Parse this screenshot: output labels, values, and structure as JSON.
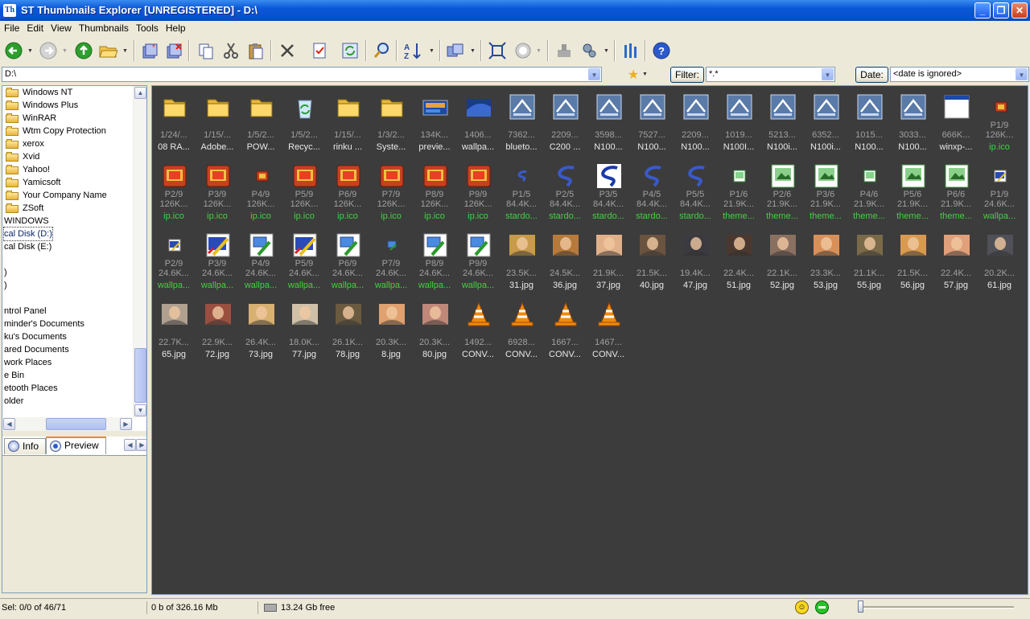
{
  "window": {
    "title": "ST Thumbnails Explorer [UNREGISTERED] - D:\\",
    "app_icon_text": "Th"
  },
  "menu": [
    {
      "label": "File"
    },
    {
      "label": "Edit"
    },
    {
      "label": "View"
    },
    {
      "label": "Thumbnails"
    },
    {
      "label": "Tools"
    },
    {
      "label": "Help"
    }
  ],
  "toolbar": {
    "icons": [
      "back-icon",
      "forward-icon",
      "up-icon",
      "folder-open-icon",
      "new-item-icon",
      "delete-item-icon",
      "copy-icon",
      "cut-icon",
      "paste-icon",
      "delete-icon",
      "properties-icon",
      "refresh-icon",
      "search-icon",
      "sort-icon",
      "view-mode-icon",
      "fit-icon",
      "stop-icon",
      "plugin-icon",
      "settings-icon",
      "tools-icon",
      "help-icon"
    ]
  },
  "address": {
    "value": "D:\\"
  },
  "filter": {
    "button": "Filter:",
    "value": "*.*"
  },
  "date": {
    "button": "Date:",
    "value": "<date is ignored>"
  },
  "tree": [
    {
      "label": "Windows NT",
      "folder": true
    },
    {
      "label": "Windows Plus",
      "folder": true
    },
    {
      "label": "WinRAR",
      "folder": true
    },
    {
      "label": "Wtm Copy Protection",
      "folder": true
    },
    {
      "label": "xerox",
      "folder": true
    },
    {
      "label": "Xvid",
      "folder": true
    },
    {
      "label": "Yahoo!",
      "folder": true
    },
    {
      "label": "Yamicsoft",
      "folder": true
    },
    {
      "label": "Your Company Name",
      "folder": true
    },
    {
      "label": "ZSoft",
      "folder": true
    },
    {
      "label": "WINDOWS",
      "folder": false
    },
    {
      "label": "cal Disk (D:)",
      "folder": false,
      "selected": true
    },
    {
      "label": "cal Disk (E:)",
      "folder": false
    },
    {
      "label": "",
      "folder": false
    },
    {
      "label": ")",
      "folder": false
    },
    {
      "label": ")",
      "folder": false
    },
    {
      "label": "",
      "folder": false
    },
    {
      "label": "ntrol Panel",
      "folder": false
    },
    {
      "label": "minder's Documents",
      "folder": false
    },
    {
      "label": "ku's Documents",
      "folder": false
    },
    {
      "label": "ared Documents",
      "folder": false
    },
    {
      "label": "work Places",
      "folder": false
    },
    {
      "label": "e Bin",
      "folder": false
    },
    {
      "label": "etooth Places",
      "folder": false
    },
    {
      "label": "older",
      "folder": false
    }
  ],
  "tabs": [
    {
      "label": "Info"
    },
    {
      "label": "Preview"
    }
  ],
  "thumbnails": [
    {
      "line1": "1/24/...",
      "line3": "08 RA...",
      "kind": "folder"
    },
    {
      "line1": "1/15/...",
      "line3": "Adobe...",
      "kind": "folder"
    },
    {
      "line1": "1/5/2...",
      "line3": "POW...",
      "kind": "folder"
    },
    {
      "line1": "1/5/2...",
      "line3": "Recyc...",
      "kind": "recycle"
    },
    {
      "line1": "1/15/...",
      "line3": "rinku ...",
      "kind": "folder"
    },
    {
      "line1": "1/3/2...",
      "line3": "Syste...",
      "kind": "folder"
    },
    {
      "line1": "134K...",
      "line3": "previe...",
      "kind": "screen"
    },
    {
      "line1": "1406...",
      "line3": "wallpa...",
      "kind": "wallpaper"
    },
    {
      "line1": "7362...",
      "line3": "blueto...",
      "kind": "doc"
    },
    {
      "line1": "2209...",
      "line3": "C200 ...",
      "kind": "doc"
    },
    {
      "line1": "3598...",
      "line3": "N100...",
      "kind": "doc"
    },
    {
      "line1": "7527...",
      "line3": "N100...",
      "kind": "doc"
    },
    {
      "line1": "2209...",
      "line3": "N100...",
      "kind": "doc"
    },
    {
      "line1": "1019...",
      "line3": "N100I...",
      "kind": "doc"
    },
    {
      "line1": "5213...",
      "line3": "N100i...",
      "kind": "doc"
    },
    {
      "line1": "6352...",
      "line3": "N100i...",
      "kind": "doc"
    },
    {
      "line1": "1015...",
      "line3": "N100...",
      "kind": "doc"
    },
    {
      "line1": "3033...",
      "line3": "N100...",
      "kind": "doc"
    },
    {
      "line1": "666K...",
      "line3": "winxp-...",
      "kind": "window"
    },
    {
      "line2": "P1/9",
      "line1": "126K...",
      "line3": "ip.ico",
      "kind": "book-small",
      "green": true
    },
    {
      "line2": "P2/9",
      "line1": "126K...",
      "line3": "ip.ico",
      "kind": "book",
      "green": true
    },
    {
      "line2": "P3/9",
      "line1": "126K...",
      "line3": "ip.ico",
      "kind": "book",
      "green": true
    },
    {
      "line2": "P4/9",
      "line1": "126K...",
      "line3": "ip.ico",
      "kind": "book-small",
      "green": true
    },
    {
      "line2": "P5/9",
      "line1": "126K...",
      "line3": "ip.ico",
      "kind": "book",
      "green": true
    },
    {
      "line2": "P6/9",
      "line1": "126K...",
      "line3": "ip.ico",
      "kind": "book",
      "green": true
    },
    {
      "line2": "P7/9",
      "line1": "126K...",
      "line3": "ip.ico",
      "kind": "book",
      "green": true
    },
    {
      "line2": "P8/9",
      "line1": "126K...",
      "line3": "ip.ico",
      "kind": "book",
      "green": true
    },
    {
      "line2": "P9/9",
      "line1": "126K...",
      "line3": "ip.ico",
      "kind": "book",
      "green": true
    },
    {
      "line2": "P1/5",
      "line1": "84.4K...",
      "line3": "stardo...",
      "kind": "star-small",
      "green": true
    },
    {
      "line2": "P2/5",
      "line1": "84.4K...",
      "line3": "stardo...",
      "kind": "star",
      "green": true
    },
    {
      "line2": "P3/5",
      "line1": "84.4K...",
      "line3": "stardo...",
      "kind": "star-white",
      "green": true
    },
    {
      "line2": "P4/5",
      "line1": "84.4K...",
      "line3": "stardo...",
      "kind": "star",
      "green": true
    },
    {
      "line2": "P5/5",
      "line1": "84.4K...",
      "line3": "stardo...",
      "kind": "star",
      "green": true
    },
    {
      "line2": "P1/6",
      "line1": "21.9K...",
      "line3": "theme...",
      "kind": "theme-small",
      "green": true
    },
    {
      "line2": "P2/6",
      "line1": "21.9K...",
      "line3": "theme...",
      "kind": "theme",
      "green": true
    },
    {
      "line2": "P3/6",
      "line1": "21.9K...",
      "line3": "theme...",
      "kind": "theme",
      "green": true
    },
    {
      "line2": "P4/6",
      "line1": "21.9K...",
      "line3": "theme...",
      "kind": "theme-small",
      "green": true
    },
    {
      "line2": "P5/6",
      "line1": "21.9K...",
      "line3": "theme...",
      "kind": "theme",
      "green": true
    },
    {
      "line2": "P6/6",
      "line1": "21.9K...",
      "line3": "theme...",
      "kind": "theme",
      "green": true
    },
    {
      "line2": "P1/9",
      "line1": "24.6K...",
      "line3": "wallpa...",
      "kind": "paint-small",
      "green": true
    },
    {
      "line2": "P2/9",
      "line1": "24.6K...",
      "line3": "wallpa...",
      "kind": "paint-small",
      "green": true
    },
    {
      "line2": "P3/9",
      "line1": "24.6K...",
      "line3": "wallpa...",
      "kind": "paint",
      "green": true
    },
    {
      "line2": "P4/9",
      "line1": "24.6K...",
      "line3": "wallpa...",
      "kind": "monitor",
      "green": true
    },
    {
      "line2": "P5/9",
      "line1": "24.6K...",
      "line3": "wallpa...",
      "kind": "paint",
      "green": true
    },
    {
      "line2": "P6/9",
      "line1": "24.6K...",
      "line3": "wallpa...",
      "kind": "monitor",
      "green": true
    },
    {
      "line2": "P7/9",
      "line1": "24.6K...",
      "line3": "wallpa...",
      "kind": "monitor-small",
      "green": true
    },
    {
      "line2": "P8/9",
      "line1": "24.6K...",
      "line3": "wallpa...",
      "kind": "monitor",
      "green": true
    },
    {
      "line2": "P9/9",
      "line1": "24.6K...",
      "line3": "wallpa...",
      "kind": "monitor",
      "green": true
    },
    {
      "line1": "23.5K...",
      "line3": "31.jpg",
      "kind": "photo",
      "tone": "#c89a4a"
    },
    {
      "line1": "24.5K...",
      "line3": "36.jpg",
      "kind": "photo",
      "tone": "#b87a3a"
    },
    {
      "line1": "21.9K...",
      "line3": "37.jpg",
      "kind": "photo",
      "tone": "#e0b08a"
    },
    {
      "line1": "21.5K...",
      "line3": "40.jpg",
      "kind": "photo",
      "tone": "#6a5440"
    },
    {
      "line1": "19.4K...",
      "line3": "47.jpg",
      "kind": "photo",
      "tone": "#3a3a40"
    },
    {
      "line1": "22.4K...",
      "line3": "51.jpg",
      "kind": "photo",
      "tone": "#4a3830"
    },
    {
      "line1": "22.1K...",
      "line3": "52.jpg",
      "kind": "photo",
      "tone": "#8a7060"
    },
    {
      "line1": "23.3K...",
      "line3": "53.jpg",
      "kind": "photo",
      "tone": "#d8905a"
    },
    {
      "line1": "21.1K...",
      "line3": "55.jpg",
      "kind": "photo",
      "tone": "#7a6a4a"
    },
    {
      "line1": "21.5K...",
      "line3": "56.jpg",
      "kind": "photo",
      "tone": "#d89a50"
    },
    {
      "line1": "22.4K...",
      "line3": "57.jpg",
      "kind": "photo",
      "tone": "#e0a07a"
    },
    {
      "line1": "20.2K...",
      "line3": "61.jpg",
      "kind": "photo",
      "tone": "#505058"
    },
    {
      "line1": "22.7K...",
      "line3": "65.jpg",
      "kind": "photo",
      "tone": "#b0a090"
    },
    {
      "line1": "22.9K...",
      "line3": "72.jpg",
      "kind": "photo",
      "tone": "#9a5040"
    },
    {
      "line1": "26.4K...",
      "line3": "73.jpg",
      "kind": "photo",
      "tone": "#d8b070"
    },
    {
      "line1": "18.0K...",
      "line3": "77.jpg",
      "kind": "photo",
      "tone": "#d0c0a8"
    },
    {
      "line1": "26.1K...",
      "line3": "78.jpg",
      "kind": "photo",
      "tone": "#6a5a40"
    },
    {
      "line1": "20.3K...",
      "line3": "8.jpg",
      "kind": "photo",
      "tone": "#e0a070"
    },
    {
      "line1": "20.3K...",
      "line3": "80.jpg",
      "kind": "photo",
      "tone": "#c08878"
    },
    {
      "line1": "1492...",
      "line3": "CONV...",
      "kind": "cone"
    },
    {
      "line1": "6928...",
      "line3": "CONV...",
      "kind": "cone"
    },
    {
      "line1": "1667...",
      "line3": "CONV...",
      "kind": "cone"
    },
    {
      "line1": "1467...",
      "line3": "CONV...",
      "kind": "cone"
    }
  ],
  "status": {
    "selection": "Sel: 0/0 of 46/71",
    "size": "0 b of 326.16 Mb",
    "free": "13.24 Gb free"
  },
  "colors": {
    "title_bar": "#0a58d8",
    "main_bg": "#3c3c3c",
    "accent_green": "#3fd43f"
  }
}
